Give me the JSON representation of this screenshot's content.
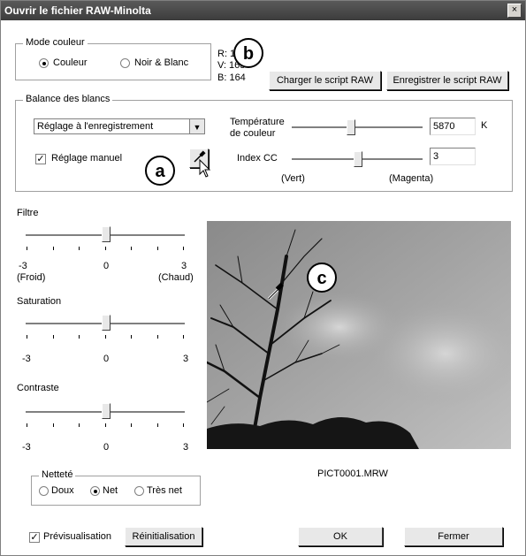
{
  "window": {
    "title": "Ouvrir le fichier RAW-Minolta",
    "close_glyph": "×"
  },
  "mode_couleur": {
    "legend": "Mode couleur",
    "options": [
      "Couleur",
      "Noir & Blanc"
    ],
    "selected": "Couleur"
  },
  "rgb": {
    "r": "R: 163",
    "v": "V: 163",
    "b": "B: 164"
  },
  "buttons": {
    "load_script": "Charger le script RAW",
    "save_script": "Enregistrer le script RAW",
    "ok": "OK",
    "close": "Fermer",
    "reset": "Réinitialisation"
  },
  "balance": {
    "legend": "Balance des blancs",
    "preset_value": "Réglage à l'enregistrement",
    "manual_label": "Réglage manuel",
    "manual_checked": true,
    "temp_label_1": "Température",
    "temp_label_2": "de couleur",
    "temp_value": "5870",
    "temp_unit": "K",
    "cc_label": "Index CC",
    "cc_value": "3",
    "cc_left": "(Vert)",
    "cc_right": "(Magenta)"
  },
  "filtre": {
    "label": "Filtre",
    "min": "-3",
    "mid": "0",
    "max": "3",
    "min_sub": "(Froid)",
    "max_sub": "(Chaud)"
  },
  "saturation": {
    "label": "Saturation",
    "min": "-3",
    "mid": "0",
    "max": "3"
  },
  "contraste": {
    "label": "Contraste",
    "min": "-3",
    "mid": "0",
    "max": "3"
  },
  "nettete": {
    "legend": "Netteté",
    "options": [
      "Doux",
      "Net",
      "Très net"
    ],
    "selected": "Net"
  },
  "preview": {
    "label": "Prévisualisation",
    "checked": true,
    "filename": "PICT0001.MRW"
  },
  "callouts": {
    "a": "a",
    "b": "b",
    "c": "c"
  },
  "icons": {
    "eyedropper": "eyedropper-icon",
    "cursor": "arrow-cursor-icon"
  }
}
